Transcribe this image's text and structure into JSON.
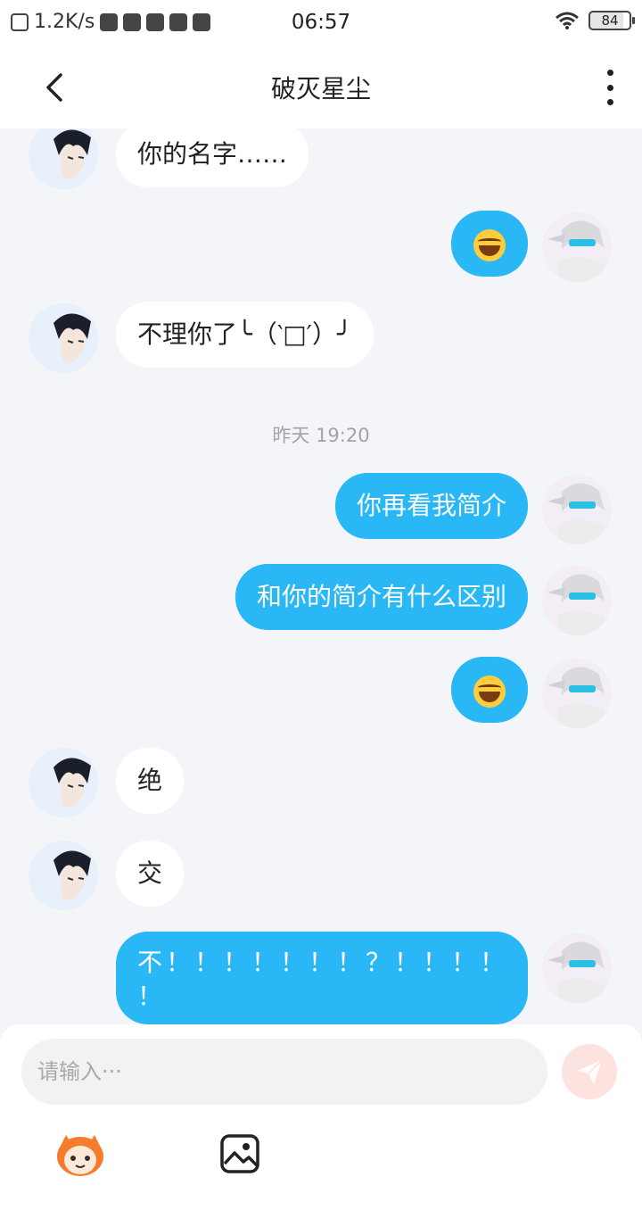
{
  "status_bar": {
    "speed": "1.2K/s",
    "time": "06:57",
    "battery": "84"
  },
  "header": {
    "title": "破灭星尘"
  },
  "messages": [
    {
      "side": "in",
      "text": "你的名字……"
    },
    {
      "side": "out",
      "emoji": "laughing-tears-emoji"
    },
    {
      "side": "in",
      "text": "不理你了╰（‵□′）╯"
    },
    {
      "type": "timestamp",
      "text": "昨天 19:20"
    },
    {
      "side": "out",
      "text": "你再看我简介"
    },
    {
      "side": "out",
      "text": "和你的简介有什么区别"
    },
    {
      "side": "out",
      "emoji": "laughing-tears-emoji"
    },
    {
      "side": "in",
      "text": "绝"
    },
    {
      "side": "in",
      "text": "交"
    },
    {
      "side": "out",
      "line1": "不！！！！！！！？！！！！",
      "line2": "！"
    }
  ],
  "composer": {
    "placeholder": "请输入···"
  },
  "colors": {
    "outgoing_bubble": "#29b7f6",
    "incoming_bubble": "#ffffff",
    "background": "#f3f5f9",
    "send_button": "#fde3e0"
  }
}
